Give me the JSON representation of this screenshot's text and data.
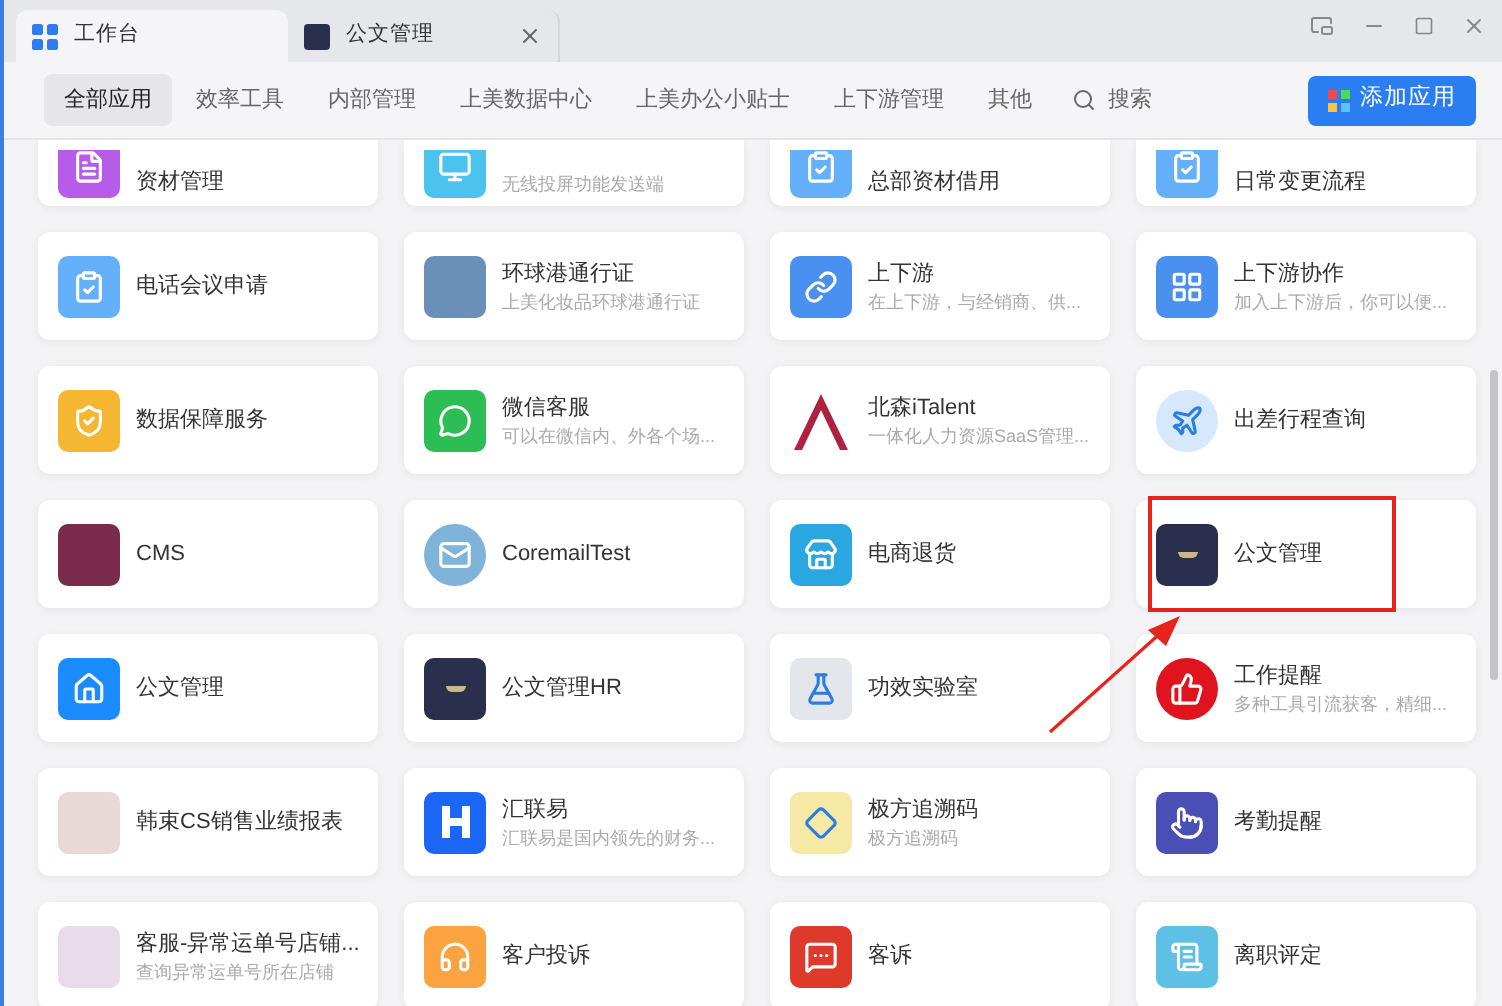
{
  "window_tabs": [
    {
      "label": "工作台",
      "selected": true,
      "kind": "grid",
      "closable": false
    },
    {
      "label": "公文管理",
      "selected": false,
      "kind": "logo",
      "closable": true
    }
  ],
  "nav": {
    "items": [
      {
        "label": "全部应用",
        "selected": true
      },
      {
        "label": "效率工具",
        "selected": false
      },
      {
        "label": "内部管理",
        "selected": false
      },
      {
        "label": "上美数据中心",
        "selected": false
      },
      {
        "label": "上美办公小贴士",
        "selected": false
      },
      {
        "label": "上下游管理",
        "selected": false
      },
      {
        "label": "其他",
        "selected": false
      }
    ],
    "search": "搜索",
    "add_button": "添加应用"
  },
  "apps": [
    {
      "title": "资材管理",
      "kind": "doc",
      "color": "#b65ce8",
      "highlighted": false
    },
    {
      "subtitle": "无线投屏功能发送端",
      "kind": "screen",
      "color": "#4cc3ef",
      "highlighted": false
    },
    {
      "title": "总部资材借用",
      "kind": "clipboard",
      "color": "#64b0fb",
      "highlighted": false
    },
    {
      "title": "日常变更流程",
      "kind": "clipboard",
      "color": "#64b0fb",
      "highlighted": false
    },
    {
      "title": "电话会议申请",
      "kind": "clipboard",
      "color": "#64b0fb",
      "highlighted": false
    },
    {
      "title": "环球港通行证",
      "subtitle": "上美化妆品环球港通行证",
      "kind": "photo",
      "color": "#6a8fb8",
      "highlighted": false
    },
    {
      "title": "上下游",
      "subtitle": "在上下游，与经销商、供...",
      "kind": "link",
      "color": "#4a90f0",
      "highlighted": false
    },
    {
      "title": "上下游协作",
      "subtitle": "加入上下游后，你可以便...",
      "kind": "grid",
      "color": "#4a90f0",
      "highlighted": false
    },
    {
      "title": "数据保障服务",
      "kind": "shield",
      "color": "#f5b731",
      "highlighted": false
    },
    {
      "title": "微信客服",
      "subtitle": "可以在微信内、外各个场...",
      "kind": "chat",
      "color": "#2dbd55",
      "highlighted": false
    },
    {
      "title": "北森iTalent",
      "subtitle": "一体化人力资源SaaS管理...",
      "kind": "peak",
      "color": "#b0203f",
      "highlighted": false
    },
    {
      "title": "出差行程查询",
      "kind": "plane",
      "color": "#d6e8fb",
      "highlighted": false
    },
    {
      "title": "CMS",
      "kind": "photo",
      "color": "#7a2a4a",
      "highlighted": false
    },
    {
      "title": "CoremailTest",
      "kind": "mail",
      "color": "#7fb3d8",
      "highlighted": false
    },
    {
      "title": "电商退货",
      "kind": "store",
      "color": "#2aa6e0",
      "highlighted": false
    },
    {
      "title": "公文管理",
      "kind": "crest",
      "color": "#2a2f4e",
      "highlighted": true
    },
    {
      "title": "公文管理",
      "kind": "home",
      "color": "#1a8cff",
      "highlighted": false
    },
    {
      "title": "公文管理HR",
      "kind": "crest",
      "color": "#2a2f4e",
      "highlighted": false
    },
    {
      "title": "功效实验室",
      "kind": "flask",
      "color": "#e3e6ea",
      "highlighted": false
    },
    {
      "title": "工作提醒",
      "subtitle": "多种工具引流获客，精细...",
      "kind": "thumb",
      "color": "#e0141e",
      "highlighted": false
    },
    {
      "title": "韩束CS销售业绩报表",
      "kind": "photo",
      "color": "#e9d9d6",
      "highlighted": false
    },
    {
      "title": "汇联易",
      "subtitle": "汇联易是国内领先的财务...",
      "kind": "h",
      "color": "#1b66f5",
      "highlighted": false
    },
    {
      "title": "极方追溯码",
      "subtitle": "极方追溯码",
      "kind": "diamond",
      "color": "#f6e9a6",
      "highlighted": false
    },
    {
      "title": "考勤提醒",
      "kind": "finger",
      "color": "#4a4fb5",
      "highlighted": false
    },
    {
      "title": "客服-异常运单号店铺...",
      "subtitle": "查询异常运单号所在店铺",
      "kind": "photo",
      "color": "#e6dde9",
      "highlighted": false
    },
    {
      "title": "客户投诉",
      "kind": "headset",
      "color": "#fba341",
      "highlighted": false
    },
    {
      "title": "客诉",
      "kind": "message",
      "color": "#de3a2c",
      "highlighted": false
    },
    {
      "title": "离职评定",
      "kind": "scroll",
      "color": "#5fc0e6",
      "highlighted": false
    }
  ]
}
